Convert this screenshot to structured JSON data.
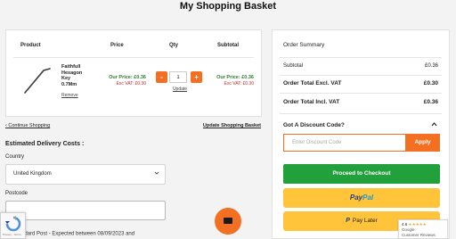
{
  "page": {
    "title": "My Shopping Basket"
  },
  "basket": {
    "headers": {
      "product": "Product",
      "price": "Price",
      "qty": "Qty",
      "subtotal": "Subtotal"
    },
    "item": {
      "name_lines": [
        "Faithfull",
        "Hexagon",
        "Key",
        "0.7Mm"
      ],
      "remove": "Remove",
      "price_our": "Our Price: £0.36",
      "price_exc": "Exc VAT: £0.30",
      "qty_minus": "-",
      "qty_value": "1",
      "qty_plus": "+",
      "update": "Update",
      "subtotal_our": "Our Price: £0.36",
      "subtotal_exc": "Exc VAT: £0.30"
    },
    "continue": "Continue Shopping",
    "continue_arrow": "‹",
    "update_basket": "Update Shopping Basket"
  },
  "delivery": {
    "heading": "Estimated Delivery Costs :",
    "country_label": "Country",
    "country_value": "United Kingdom",
    "postcode_label": "Postcode",
    "postcode_value": "",
    "shipping_option": "Standard Post - Expected between 08/09/2023 and"
  },
  "summary": {
    "title": "Order Summary",
    "subtotal_label": "Subtotal",
    "subtotal_value": "£0.36",
    "excl_label": "Order Total Excl. VAT",
    "excl_value": "£0.30",
    "incl_label": "Order Total Incl. VAT",
    "incl_value": "£0.36",
    "discount_label": "Got A Discount Code?",
    "discount_caret": "^",
    "discount_placeholder": "Enter Discount Code",
    "apply": "Apply",
    "checkout": "Proceed to Checkout",
    "paypal_pay": "Pay",
    "paypal_pal": "Pal",
    "paylater_icon": "P",
    "paylater": "Pay Later"
  },
  "google_reviews": {
    "rating": "4.6",
    "stars": "★★★★★",
    "brand": "Google",
    "label": "Customer Reviews"
  },
  "recaptcha": {
    "text": "Privacy - Terms"
  },
  "colors": {
    "accent": "#f36f21",
    "checkout": "#22a03c",
    "paypal": "#ffc439",
    "price_green": "#2e7d2e",
    "exc_red": "#c62828"
  },
  "icons": {
    "chevron": "chevron-down-icon",
    "chat": "chat-icon",
    "recaptcha": "recaptcha-icon",
    "caret": "caret-up-icon"
  }
}
